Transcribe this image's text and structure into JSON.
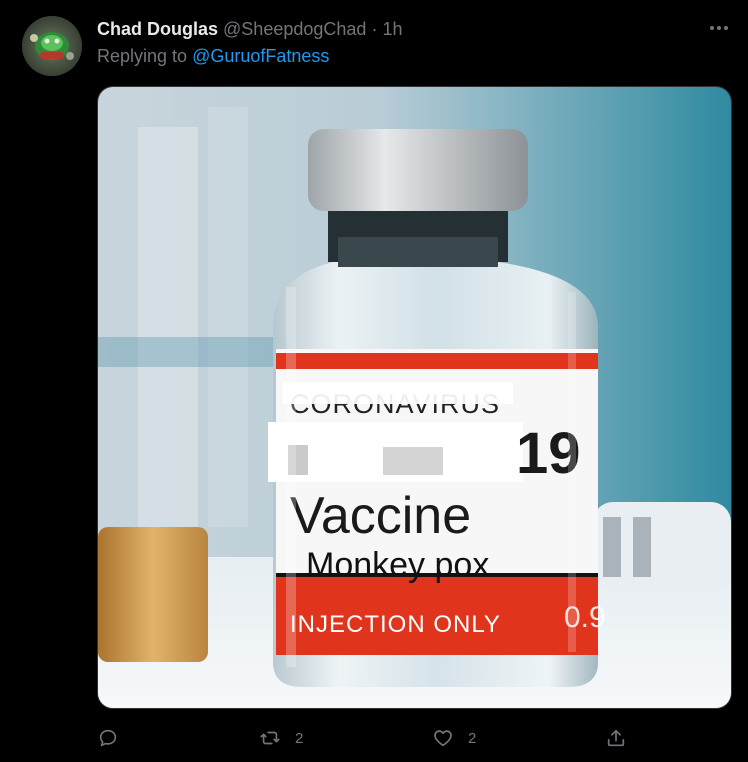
{
  "tweet": {
    "author_name": "Chad Douglas",
    "author_handle": "@SheepdogChad",
    "separator": "·",
    "time": "1h",
    "replying_prefix": "Replying to",
    "replying_to": "@GuruofFatness"
  },
  "image_label": {
    "line1": "CORONAVIRUS",
    "line2_suffix": "19",
    "line3": "Vaccine",
    "line4": "Monkey pox",
    "footer": "INJECTION ONLY",
    "footer_value": "0.9"
  },
  "actions": {
    "reply_count": "",
    "retweet_count": "2",
    "like_count": "2"
  },
  "icons": {
    "more": "more-icon",
    "reply": "reply-icon",
    "retweet": "retweet-icon",
    "like": "heart-icon",
    "share": "share-icon"
  },
  "colors": {
    "background": "#000000",
    "link": "#1d9bf0",
    "secondary_text": "#71767b",
    "label_red": "#e0351c"
  }
}
